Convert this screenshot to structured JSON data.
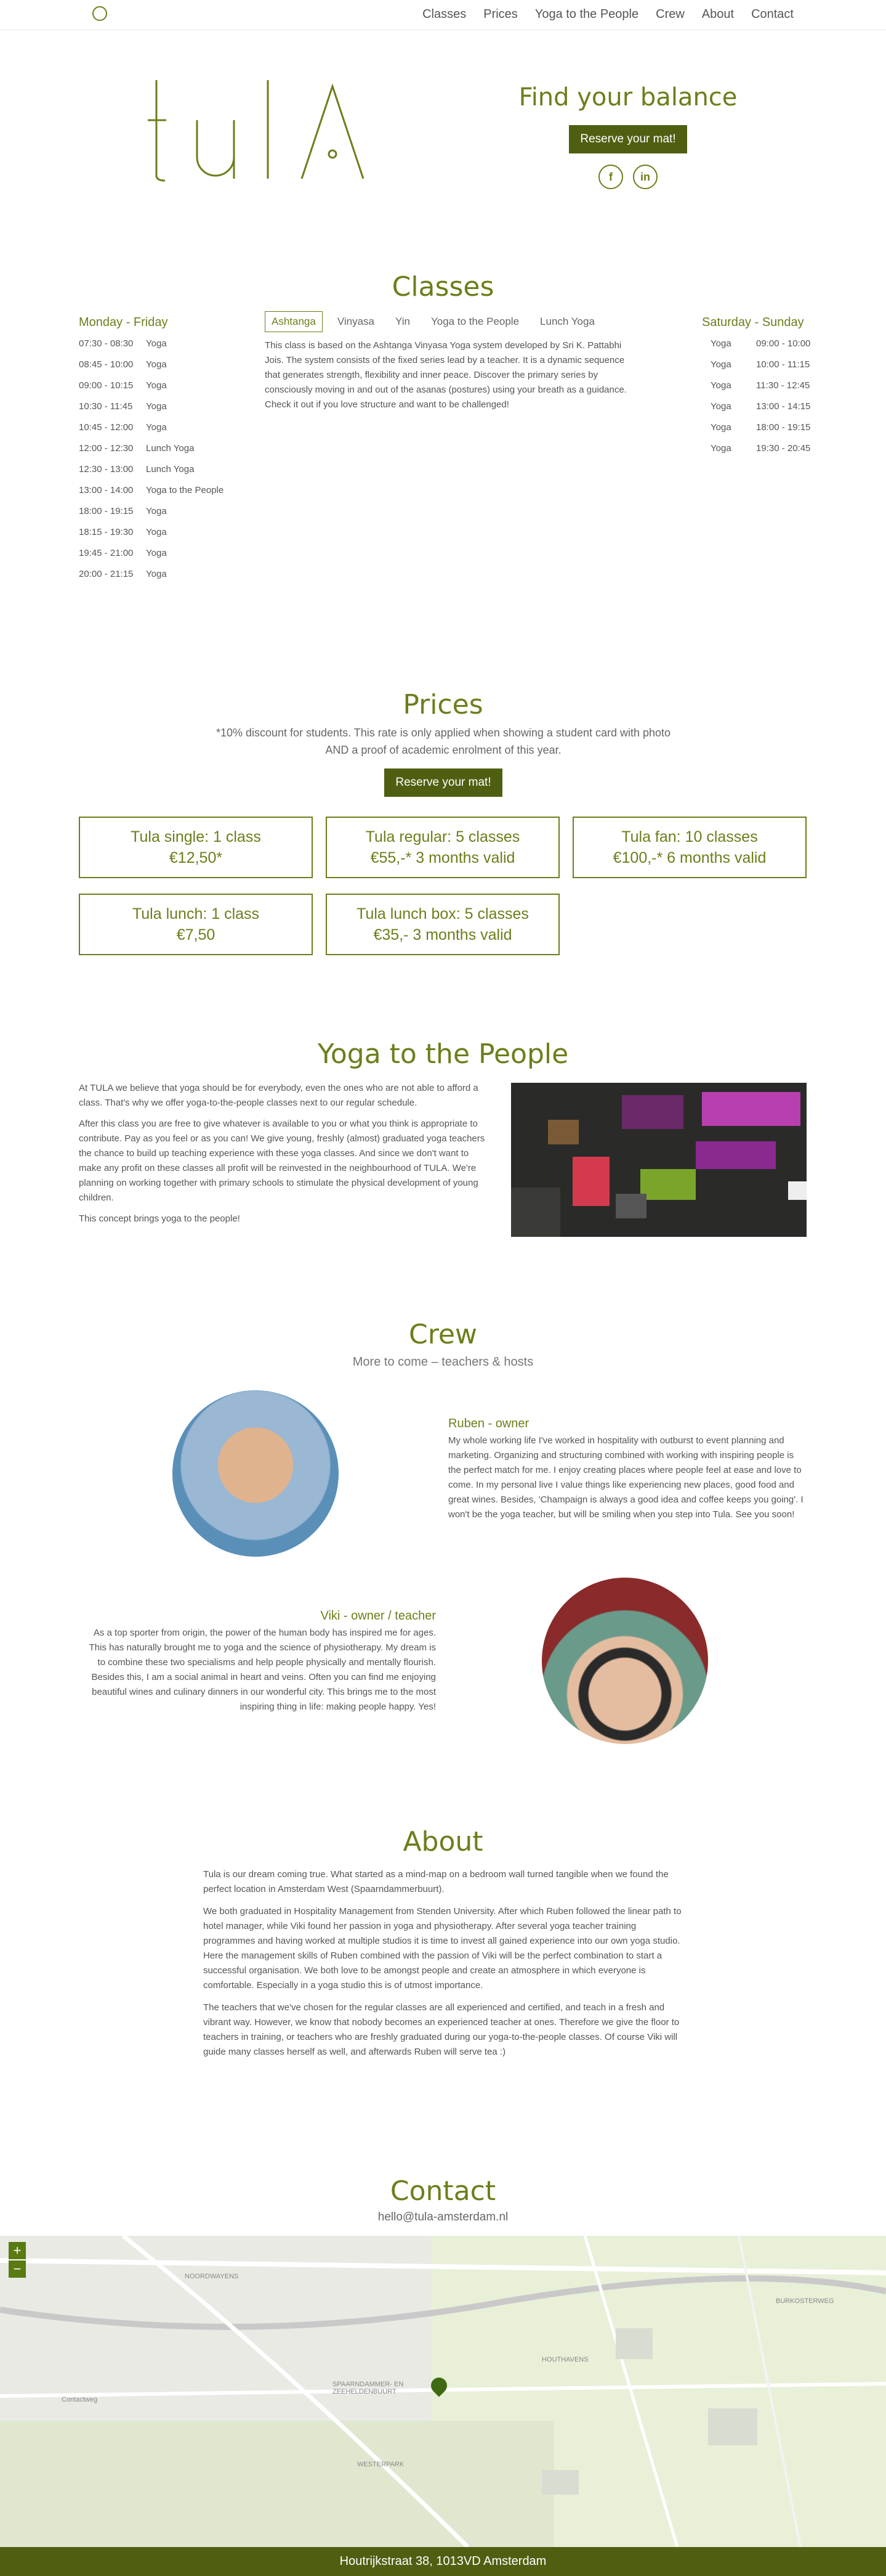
{
  "nav": {
    "links": [
      "Classes",
      "Prices",
      "Yoga to the People",
      "Crew",
      "About",
      "Contact"
    ]
  },
  "hero": {
    "logo_text": "tula",
    "tagline": "Find your balance",
    "reserve_label": "Reserve your mat!",
    "social": {
      "facebook": "f",
      "linkedin": "in"
    }
  },
  "classes": {
    "title": "Classes",
    "weekday": {
      "heading": "Monday - Friday",
      "rows": [
        {
          "time": "07:30 - 08:30",
          "name": "Yoga"
        },
        {
          "time": "08:45 - 10:00",
          "name": "Yoga"
        },
        {
          "time": "09:00 - 10:15",
          "name": "Yoga"
        },
        {
          "time": "10:30 - 11:45",
          "name": "Yoga"
        },
        {
          "time": "10:45 - 12:00",
          "name": "Yoga"
        },
        {
          "time": "12:00 - 12:30",
          "name": "Lunch Yoga"
        },
        {
          "time": "12:30 - 13:00",
          "name": "Lunch Yoga"
        },
        {
          "time": "13:00 - 14:00",
          "name": "Yoga to the People"
        },
        {
          "time": "18:00 - 19:15",
          "name": "Yoga"
        },
        {
          "time": "18:15 - 19:30",
          "name": "Yoga"
        },
        {
          "time": "19:45 - 21:00",
          "name": "Yoga"
        },
        {
          "time": "20:00 - 21:15",
          "name": "Yoga"
        }
      ]
    },
    "weekend": {
      "heading": "Saturday - Sunday",
      "rows": [
        {
          "name": "Yoga",
          "time": "09:00 - 10:00"
        },
        {
          "name": "Yoga",
          "time": "10:00 - 11:15"
        },
        {
          "name": "Yoga",
          "time": "11:30 - 12:45"
        },
        {
          "name": "Yoga",
          "time": "13:00 - 14:15"
        },
        {
          "name": "Yoga",
          "time": "18:00 - 19:15"
        },
        {
          "name": "Yoga",
          "time": "19:30 - 20:45"
        }
      ]
    },
    "tabs": [
      "Ashtanga",
      "Vinyasa",
      "Yin",
      "Yoga to the People",
      "Lunch Yoga"
    ],
    "active_tab_text": "This class is based on the Ashtanga Vinyasa Yoga system developed by Sri K. Pattabhi Jois. The system consists of the fixed series lead by a teacher. It is a dynamic sequence that generates strength, flexibility and inner peace. Discover the primary series by consciously moving in and out of the asanas (postures) using your breath as a guidance. Check it out if you love structure and want to be challenged!"
  },
  "prices": {
    "title": "Prices",
    "note_line1": "*10% discount for students. This rate is only applied when showing a student card with photo",
    "note_line2": "AND a proof of academic enrolment of this year.",
    "reserve_label": "Reserve your mat!",
    "cards": [
      {
        "name": "Tula single: 1 class",
        "price": "€12,50*"
      },
      {
        "name": "Tula regular: 5 classes",
        "price": "€55,-* 3 months valid"
      },
      {
        "name": "Tula fan: 10 classes",
        "price": "€100,-* 6 months valid"
      },
      {
        "name": "Tula lunch: 1 class",
        "price": "€7,50"
      },
      {
        "name": "Tula lunch box: 5 classes",
        "price": "€35,- 3 months valid"
      }
    ]
  },
  "ytp": {
    "title": "Yoga to the People",
    "p1": "At TULA we believe that yoga should be for everybody, even the ones who are not able to afford a class. That's why we offer yoga-to-the-people classes next to our regular schedule.",
    "p2": "After this class you are free to give whatever is available to you or what you think is appropriate to contribute. Pay as you feel or as you can! We give young, freshly (almost) graduated yoga teachers the chance to build up teaching experience with these yoga classes. And since we don't want to make any profit on these classes all profit will be reinvested in the neighbourhood of TULA. We're planning on working together with primary schools to stimulate the physical development of young children.",
    "p3": "This concept brings yoga to the people!"
  },
  "crew": {
    "title": "Crew",
    "subtitle": "More to come – teachers & hosts",
    "members": [
      {
        "name": "Ruben - owner",
        "bio": "My whole working life I've worked in hospitality with outburst to event planning and marketing. Organizing and structuring combined with working with inspiring people is the perfect match for me. I enjoy creating places where people feel at ease and love to come. In my personal live I value things like experiencing new places, good food and great wines. Besides, 'Champaign is always a good idea and coffee keeps you going'. I won't be the yoga teacher, but will be smiling when you step into Tula. See you soon!"
      },
      {
        "name": "Viki - owner / teacher",
        "bio": "As a top sporter from origin, the power of the human body has inspired me for ages. This has naturally brought me to yoga and the science of physiotherapy. My dream is to combine these two specialisms and help people physically and mentally flourish. Besides this, I am a social animal in heart and veins. Often you can find me enjoying beautiful wines and culinary dinners in our wonderful city. This brings me to the most inspiring thing in life: making people happy. Yes!"
      }
    ]
  },
  "about": {
    "title": "About",
    "p1": "Tula is our dream coming true. What started as a mind-map on a bedroom wall turned tangible when we found the perfect location in Amsterdam West (Spaarndammerbuurt).",
    "p2": "We both graduated in Hospitality Management from Stenden University. After which Ruben followed the linear path to hotel manager, while Viki found her passion in yoga and physiotherapy. After several yoga teacher training programmes and having worked at multiple studios it is time to invest all gained experience into our own yoga studio. Here the management skills of Ruben combined with the passion of Viki will be the perfect combination to start a successful organisation. We both love to be amongst people and create an atmosphere in which everyone is comfortable. Especially in a yoga studio this is of utmost importance.",
    "p3": "The teachers that we've chosen for the regular classes are all experienced and certified, and teach in a fresh and vibrant way. However, we know that nobody becomes an experienced teacher at ones. Therefore we give the floor to teachers in training, or teachers who are freshly graduated during our yoga-to-the-people classes. Of course Viki will guide many classes herself as well, and afterwards Ruben will serve tea :)"
  },
  "contact": {
    "title": "Contact",
    "email": "hello@tula-amsterdam.nl",
    "map": {
      "zoom_in": "+",
      "zoom_out": "−",
      "labels": [
        "NOORDWAYENS",
        "SPAARNDAMMER- EN ZEEHELDENBUURT",
        "HOUTHAVENS",
        "WESTERPARK",
        "BURKOSTERWEG",
        "Contactweg"
      ]
    },
    "address": "Houtrijkstraat 38, 1013VD Amsterdam"
  },
  "colors": {
    "accent": "#6b7f1a",
    "button": "#4f5f12"
  }
}
